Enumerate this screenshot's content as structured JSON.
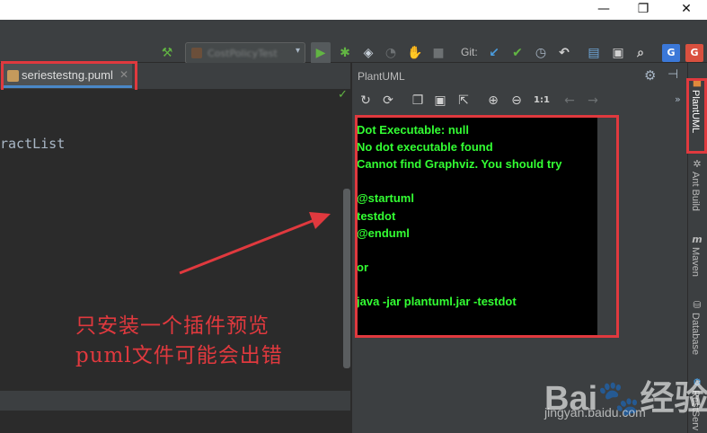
{
  "window": {
    "controls": {
      "minimize": "—",
      "maximize": "❐",
      "close": "✕"
    }
  },
  "toolbar": {
    "run_config_label": "CostPolicyTest",
    "vcs_label": "Git:",
    "icons": [
      "build-hammer-icon",
      "run-icon",
      "debug-icon",
      "coverage-icon",
      "profile-icon",
      "attach-icon",
      "stop-icon",
      "vcs-update-icon",
      "vcs-commit-icon",
      "vcs-history-icon",
      "vcs-revert-icon",
      "project-structure-icon",
      "sdk-icon",
      "search-icon",
      "translate-icon",
      "google-translate-icon"
    ]
  },
  "editor": {
    "tab": {
      "file_name": "seriestestng.puml",
      "close_glyph": "✕"
    },
    "code_fragment": "ractList",
    "inspection_ok": "✓"
  },
  "plantuml": {
    "title": "PlantUML",
    "zoom_reset_label": "1:1",
    "output_lines": [
      "Dot Executable: null",
      "No dot executable found",
      "Cannot find Graphviz. You should try",
      "",
      "@startuml",
      "testdot",
      "@enduml",
      "",
      " or",
      "",
      "java -jar plantuml.jar -testdot"
    ]
  },
  "sidebar": {
    "tabs": [
      {
        "label": "PlantUML",
        "icon": "plantuml-icon",
        "active": true
      },
      {
        "label": "Ant Build",
        "icon": "ant-icon",
        "active": false
      },
      {
        "label": "Maven",
        "icon": "maven-icon",
        "active": false
      },
      {
        "label": "Database",
        "icon": "database-icon",
        "active": false
      },
      {
        "label": "RestServ",
        "icon": "rest-services-icon",
        "active": false
      }
    ]
  },
  "annotation": {
    "line1": "只安装一个插件预览",
    "line2": "puml文件可能会出错"
  },
  "watermark": {
    "logo": "Bai🐾经验",
    "url": "jingyan.baidu.com"
  },
  "colors": {
    "highlight": "#e0393e",
    "terminal_text": "#33ff33",
    "ide_bg": "#2b2b2b",
    "panel_bg": "#3c3f41"
  }
}
